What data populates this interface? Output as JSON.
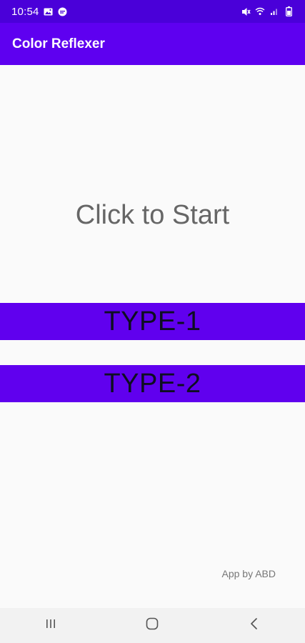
{
  "status_bar": {
    "time": "10:54",
    "left_icons": [
      "image-icon",
      "message-icon"
    ],
    "right_icons": [
      "mute-icon",
      "wifi-icon",
      "signal-icon",
      "battery-icon"
    ]
  },
  "app_bar": {
    "title": "Color Reflexer"
  },
  "main": {
    "start_text": "Click to Start",
    "buttons": [
      {
        "label": "TYPE-1"
      },
      {
        "label": "TYPE-2"
      }
    ],
    "credit": "App by ABD"
  },
  "nav_bar": {
    "buttons": [
      "recent-apps-icon",
      "home-icon",
      "back-icon"
    ]
  },
  "colors": {
    "status_bar": "#4a00d9",
    "app_bar": "#5e00f0",
    "button_bg": "#6000ee",
    "button_text": "#0e0e22",
    "background": "#fafafa",
    "nav_bar": "#f2f2f2"
  }
}
